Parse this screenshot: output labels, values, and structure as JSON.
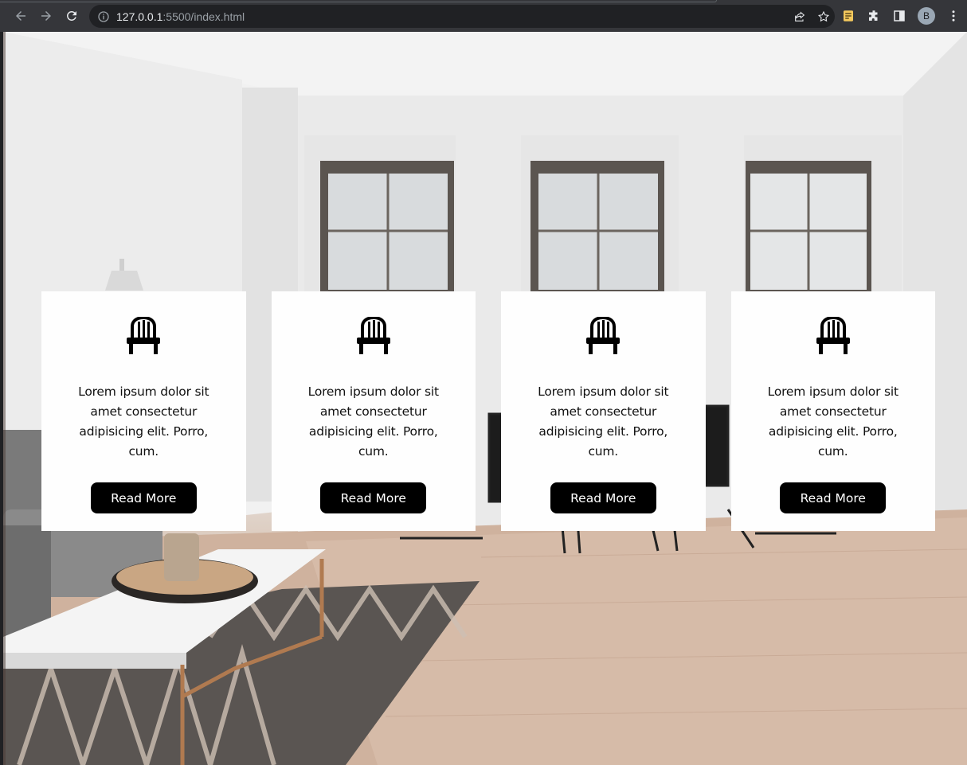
{
  "browser": {
    "url_host": "127.0.0.1",
    "url_rest": ":5500/index.html",
    "profile_initial": "B"
  },
  "cards": [
    {
      "icon": "chair-icon",
      "text": "Lorem ipsum dolor sit amet consectetur adipisicing elit. Porro, cum.",
      "button": "Read More"
    },
    {
      "icon": "chair-icon",
      "text": "Lorem ipsum dolor sit amet consectetur adipisicing elit. Porro, cum.",
      "button": "Read More"
    },
    {
      "icon": "chair-icon",
      "text": "Lorem ipsum dolor sit amet consectetur adipisicing elit. Porro, cum.",
      "button": "Read More"
    },
    {
      "icon": "chair-icon",
      "text": "Lorem ipsum dolor sit amet consectetur adipisicing elit. Porro, cum.",
      "button": "Read More"
    }
  ],
  "colors": {
    "card_bg": "#fefefe",
    "button_bg": "#000000",
    "button_text": "#ffffff",
    "chrome_toolbar": "#35363a",
    "omnibox_bg": "#202124"
  }
}
